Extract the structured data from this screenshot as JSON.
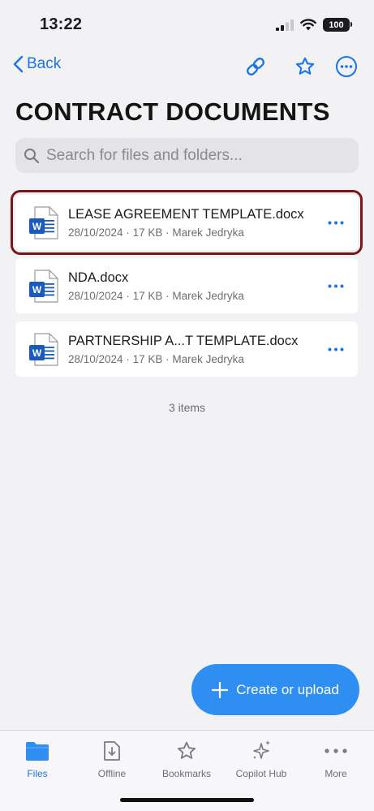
{
  "status_bar": {
    "time": "13:22",
    "battery": "100"
  },
  "nav": {
    "back_label": "Back"
  },
  "title": "CONTRACT DOCUMENTS",
  "search": {
    "placeholder": "Search for files and folders..."
  },
  "files": [
    {
      "name": "LEASE AGREEMENT TEMPLATE.docx",
      "meta": "28/10/2024 · 17 KB · Marek Jedryka",
      "selected": true
    },
    {
      "name": "NDA.docx",
      "meta": "28/10/2024 · 17 KB · Marek Jedryka",
      "selected": false
    },
    {
      "name": "PARTNERSHIP A...T TEMPLATE.docx",
      "meta": "28/10/2024 · 17 KB · Marek Jedryka",
      "selected": false
    }
  ],
  "item_count": "3 items",
  "fab_label": "Create or upload",
  "tabs": [
    {
      "label": "Files",
      "icon": "folder-icon",
      "active": true
    },
    {
      "label": "Offline",
      "icon": "offline-icon",
      "active": false
    },
    {
      "label": "Bookmarks",
      "icon": "star-icon",
      "active": false
    },
    {
      "label": "Copilot Hub",
      "icon": "sparkle-icon",
      "active": false
    },
    {
      "label": "More",
      "icon": "more-icon",
      "active": false
    }
  ],
  "colors": {
    "accent": "#1a73e8",
    "fab": "#2f8ef2",
    "word_blue": "#185abd",
    "selection": "#7a1518"
  }
}
